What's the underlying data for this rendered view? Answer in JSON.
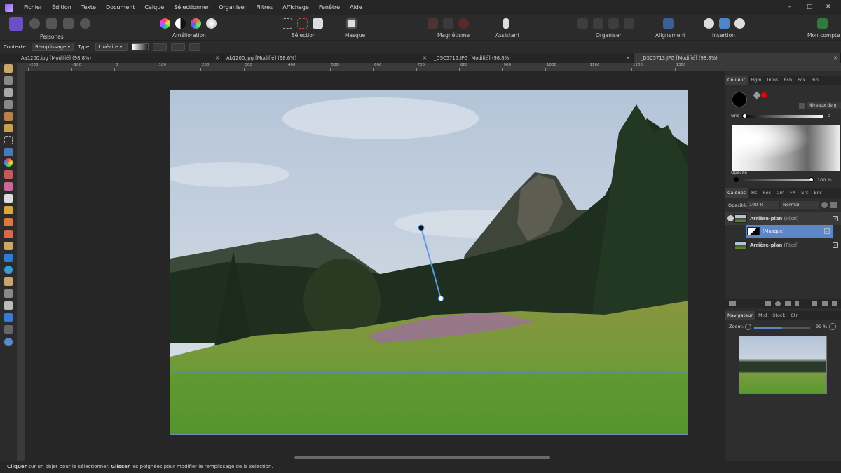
{
  "menu": [
    "Fichier",
    "Édition",
    "Texte",
    "Document",
    "Calque",
    "Sélectionner",
    "Organiser",
    "Filtres",
    "Affichage",
    "Fenêtre",
    "Aide"
  ],
  "window_controls": {
    "minimize": "–",
    "restore": "□",
    "close": "✕"
  },
  "toolbar": {
    "personas": "Personas",
    "amelioration": "Amélioration",
    "selection": "Sélection",
    "masque": "Masque",
    "magnetisme": "Magnétisme",
    "assistant": "Assistant",
    "organiser": "Organiser",
    "alignement": "Alignement",
    "insertion": "Insertion",
    "mon_compte": "Mon compte"
  },
  "context": {
    "contexte_label": "Contexte:",
    "contexte_value": "Remplissage",
    "type_label": "Type:",
    "type_value": "Linéaire"
  },
  "tabs": [
    {
      "label": "Aa1200.jpg [Modifié] (98.8%)",
      "close": "✕"
    },
    {
      "label": "Ab1200.jpg [Modifié] (98.6%)",
      "close": "✕"
    },
    {
      "label": "_DSC5715.JPG [Modifié] (98.8%)",
      "close": "✕"
    },
    {
      "label": "_DSC5713.JPG [Modifié] (98.8%)",
      "close": "✕"
    }
  ],
  "ruler_ticks": [
    "-200",
    "-100",
    "0",
    "100",
    "200",
    "300",
    "400",
    "500",
    "600",
    "700",
    "800",
    "900",
    "1000",
    "1100",
    "1200",
    "1300"
  ],
  "color_panel": {
    "tabs": [
      "Couleur",
      "Hgm",
      "Infos",
      "Éch",
      "Pcx",
      "Bib"
    ],
    "mode": "Niveaux de gr",
    "gris_label": "Gris",
    "gris_value": "0",
    "opacite_label": "Opacité",
    "opacite_value": "100 %"
  },
  "layers_panel": {
    "tabs": [
      "Calques",
      "Hs",
      "Rés",
      "Crn",
      "FX",
      "Src",
      "Enr"
    ],
    "opacite_label": "Opacité:",
    "opacite_value": "100 %",
    "blend": "Normal",
    "layers": [
      {
        "name": "Arrière-plan",
        "type": "(Pixel)",
        "checked": "✓"
      },
      {
        "name": "",
        "type": "(Masque)",
        "checked": "✓"
      },
      {
        "name": "Arrière-plan",
        "type": "(Pixel)",
        "checked": "✓"
      }
    ]
  },
  "navigator_panel": {
    "tabs": [
      "Navigateur",
      "Mtd",
      "Stock",
      "Ctn"
    ],
    "zoom_label": "Zoom:",
    "zoom_value": "99 %",
    "zoom_fraction": 0.5
  },
  "status": {
    "bold1": "Cliquer",
    "text1": " sur un objet pour le sélectionner. ",
    "bold2": "Glisser",
    "text2": " les poignées pour modifier le remplissage de la sélection."
  }
}
